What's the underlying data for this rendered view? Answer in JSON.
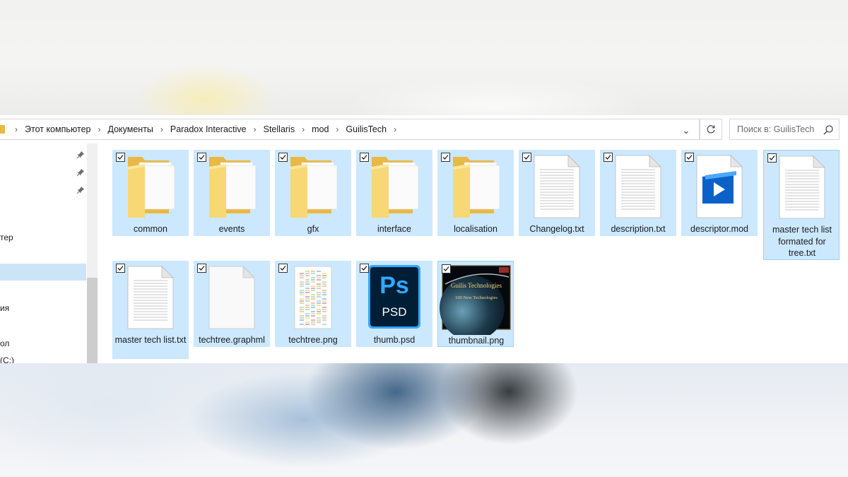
{
  "breadcrumbs": [
    "Этот компьютер",
    "Документы",
    "Paradox Interactive",
    "Stellaris",
    "mod",
    "GuilisTech"
  ],
  "search": {
    "placeholder": "Поиск в: GuilisTech"
  },
  "nav": {
    "items": [
      {
        "label": ""
      },
      {
        "label": ""
      },
      {
        "label": ""
      },
      {
        "label": "тер"
      },
      {
        "label": ""
      },
      {
        "label": "ия"
      },
      {
        "label": "ол"
      },
      {
        "label": "(C:)"
      }
    ]
  },
  "files": [
    {
      "name": "common",
      "type": "folder",
      "checked": true
    },
    {
      "name": "events",
      "type": "folder",
      "checked": true
    },
    {
      "name": "gfx",
      "type": "folder",
      "checked": true
    },
    {
      "name": "interface",
      "type": "folder",
      "checked": true
    },
    {
      "name": "localisation",
      "type": "folder",
      "checked": true
    },
    {
      "name": "Changelog.txt",
      "type": "text-file",
      "checked": true
    },
    {
      "name": "description.txt",
      "type": "text-file",
      "checked": true
    },
    {
      "name": "descriptor.mod",
      "type": "media-file",
      "checked": true
    },
    {
      "name": "master tech list formated for tree.txt",
      "type": "text-file",
      "checked": true
    },
    {
      "name": "master tech list.txt",
      "type": "text-file",
      "checked": true
    },
    {
      "name": "techtree.graphml",
      "type": "blank-file",
      "checked": true
    },
    {
      "name": "techtree.png",
      "type": "image-file",
      "checked": true
    },
    {
      "name": "thumb.psd",
      "type": "photoshop-file",
      "checked": true
    },
    {
      "name": "thumbnail.png",
      "type": "image-file",
      "checked": true
    }
  ],
  "thumbnail_text": {
    "title": "Guilis Technologies",
    "subtitle": "100 New Technologies"
  },
  "psd_icon": {
    "big": "Ps",
    "small": "PSD"
  },
  "colors": {
    "selection": "#cce8ff",
    "selection_border": "#99d1ff",
    "folder": "#f8d775",
    "psd_bg": "#001e36",
    "psd_accent": "#31a8ff"
  }
}
